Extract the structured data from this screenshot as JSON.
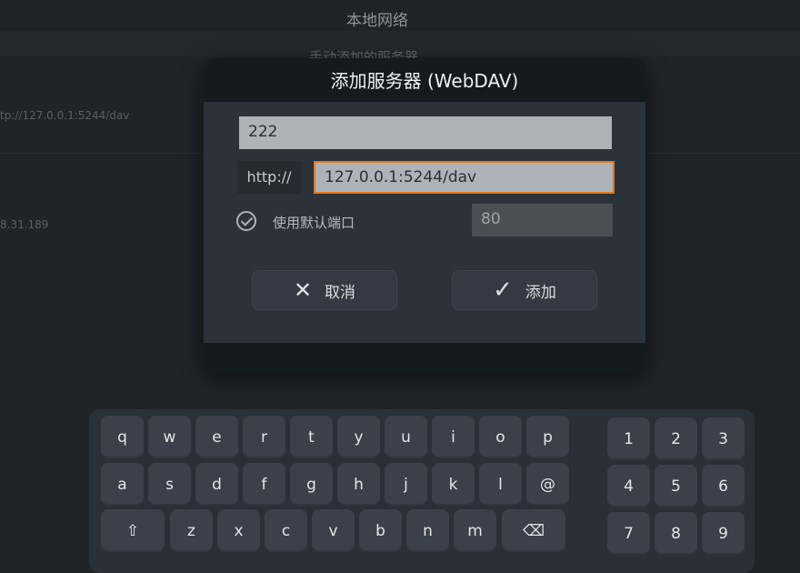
{
  "background": {
    "title": "本地网络",
    "section": "手动添加的服务器",
    "rows": [
      "tp://127.0.0.1:5244/dav",
      "8.31.189"
    ]
  },
  "dialog": {
    "title": "添加服务器 (WebDAV)",
    "name_value": "222",
    "scheme": "http://",
    "url_value": "127.0.0.1:5244/dav",
    "use_default_port_label": "使用默认端口",
    "use_default_port_checked": true,
    "port_value": "80",
    "cancel_label": "取消",
    "add_label": "添加"
  },
  "keyboard": {
    "row1": [
      "q",
      "w",
      "e",
      "r",
      "t",
      "y",
      "u",
      "i",
      "o",
      "p"
    ],
    "row2": [
      "a",
      "s",
      "d",
      "f",
      "g",
      "h",
      "j",
      "k",
      "l",
      "@"
    ],
    "row3": [
      "z",
      "x",
      "c",
      "v",
      "b",
      "n",
      "m"
    ],
    "numbers": [
      "1",
      "2",
      "3",
      "4",
      "5",
      "6",
      "7",
      "8",
      "9"
    ],
    "shift_glyph": "⇧",
    "backspace_glyph": "⌫"
  },
  "colors": {
    "accent_focus": "#e07a1f",
    "dialog_bg": "#2c323a",
    "header_bg": "#151a1f"
  }
}
